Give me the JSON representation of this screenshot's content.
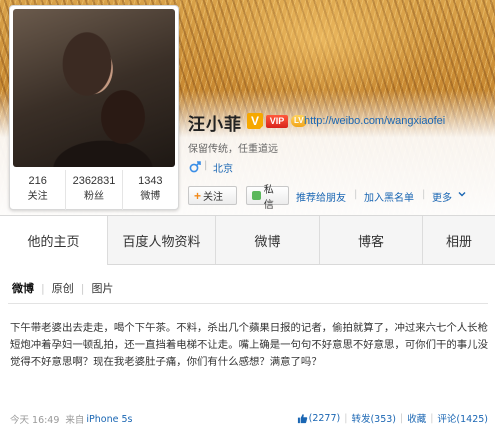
{
  "profile": {
    "name": "汪小菲",
    "vip_badge": "VIP",
    "level_badge": "LV",
    "url": "http://weibo.com/wangxiaofei",
    "bio": "保留传统，任重道远",
    "gender": "male",
    "location": "北京",
    "stats": [
      {
        "value": "216",
        "label": "关注"
      },
      {
        "value": "2362831",
        "label": "粉丝"
      },
      {
        "value": "1343",
        "label": "微博"
      }
    ]
  },
  "actions": {
    "follow": "关注",
    "message": "私信",
    "recommend": "推荐给朋友",
    "blacklist": "加入黑名单",
    "more": "更多"
  },
  "tabs": [
    "他的主页",
    "百度人物资料",
    "微博",
    "博客",
    "相册"
  ],
  "subnav": [
    "微博",
    "原创",
    "图片"
  ],
  "post": {
    "text": "下午带老婆出去走走，喝个下午茶。不料，杀出几个蘋果日报的记者，偷拍就算了，冲过来六七个人长枪短炮冲着孕妇一顿乱拍，还一直挡着电梯不让走。嘴上确是一句句不好意思不好意思，可你们干的事儿没觉得不好意思啊？现在我老婆肚子痛，你们有什么感想？满意了吗？",
    "time": "今天 16:49",
    "source_label": "来自",
    "source": "iPhone 5s",
    "likes": "(2277)",
    "repost": "转发(353)",
    "favorite": "收藏",
    "comment": "评论(1425)"
  },
  "colors": {
    "link": "#1a66b3",
    "accent_orange": "#f28a1a",
    "vip_red": "#d8231b"
  },
  "icons": [
    "v-badge-icon",
    "gender-male-icon",
    "plus-icon",
    "message-icon",
    "chevron-down-icon",
    "thumbs-up-icon"
  ]
}
